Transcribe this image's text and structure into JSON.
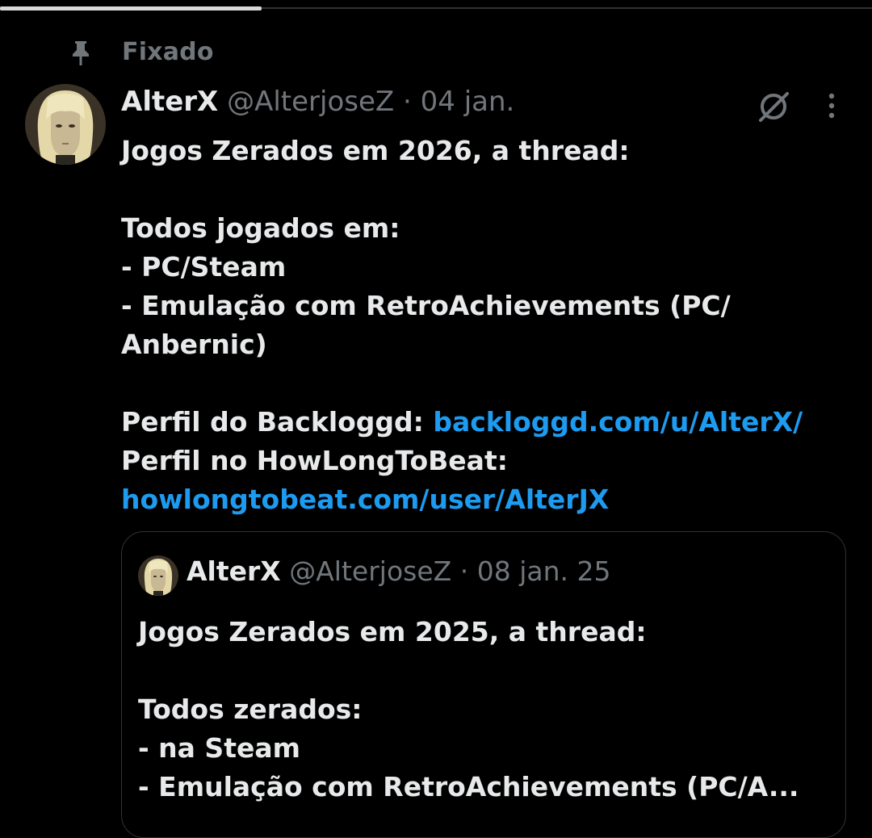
{
  "top_progress": {
    "fraction": 0.3
  },
  "pinned": {
    "label": "Fixado",
    "icon": "pin-icon"
  },
  "tweet": {
    "author_name": "AlterX",
    "handle": "@AlterjoseZ",
    "separator": " · ",
    "date": "04 jan.",
    "icons": {
      "grok": "grok-icon",
      "more": "more-icon"
    },
    "body": {
      "line1": "Jogos Zerados em 2026, a thread:",
      "line2": "Todos jogados em:",
      "line3": "- PC/Steam",
      "line4": "- Emulação com RetroAchievements (PC/",
      "line5": "Anbernic)",
      "backloggd_prefix": "Perfil do Backloggd: ",
      "backloggd_link": "backloggd.com/u/AlterX/",
      "hltb_prefix": "Perfil no HowLongToBeat:",
      "hltb_link": "howlongtobeat.com/user/AlterJX"
    }
  },
  "quote": {
    "author_name": "AlterX",
    "handle": "@AlterjoseZ",
    "separator": " · ",
    "date": "08 jan. 25",
    "body": {
      "line1": "Jogos Zerados em 2025, a thread:",
      "line2": "Todos zerados:",
      "line3": "- na Steam",
      "line4": "- Emulação com RetroAchievements (PC/A..."
    }
  },
  "colors": {
    "background": "#000000",
    "text_primary": "#e7e9ea",
    "text_secondary": "#71767b",
    "link": "#1d9bf0",
    "border": "#2f3336"
  }
}
